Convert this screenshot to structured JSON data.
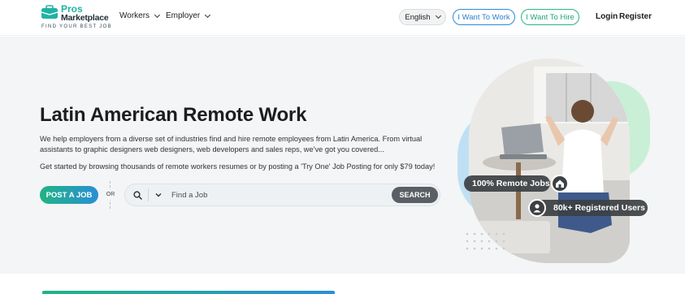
{
  "header": {
    "logo": {
      "name_line1": "Pros",
      "name_line2": "Marketplace",
      "tagline": "FIND YOUR BEST JOB"
    },
    "nav": [
      {
        "label": "Workers",
        "icon": "chevron-down-icon"
      },
      {
        "label": "Employer",
        "icon": "chevron-down-icon"
      }
    ],
    "language": {
      "label": "English",
      "icon": "chevron-down-icon"
    },
    "want_to_work": "I Want To Work",
    "want_to_hire": "I Want To Hire",
    "login": "Login",
    "register": "Register"
  },
  "hero": {
    "title": "Latin American Remote Work",
    "description": "We help employers from a diverse set of industries find and hire remote employees from Latin America. From virtual assistants to graphic designers web designers, web developers and sales reps, we’ve got you covered...",
    "cta_text": "Get started by browsing thousands of remote workers resumes or by posting a 'Try One' Job Posting for only $79 today!",
    "post_job_button": "POST A JOB",
    "or_label": "OR",
    "search": {
      "icon": "search-icon",
      "dropdown_icon": "chevron-down-icon",
      "placeholder": "Find a Job",
      "button": "SEARCH"
    },
    "badges": {
      "remote_jobs": {
        "label": "100% Remote Jobs",
        "icon": "remote-home-icon"
      },
      "registered_users": {
        "label": "80k+ Registered Users",
        "icon": "user-icon"
      }
    }
  },
  "colors": {
    "brand_teal": "#1fb3a4",
    "work_blue": "#2b7fd0",
    "hire_green": "#21a57c",
    "search_button": "#595f64"
  }
}
